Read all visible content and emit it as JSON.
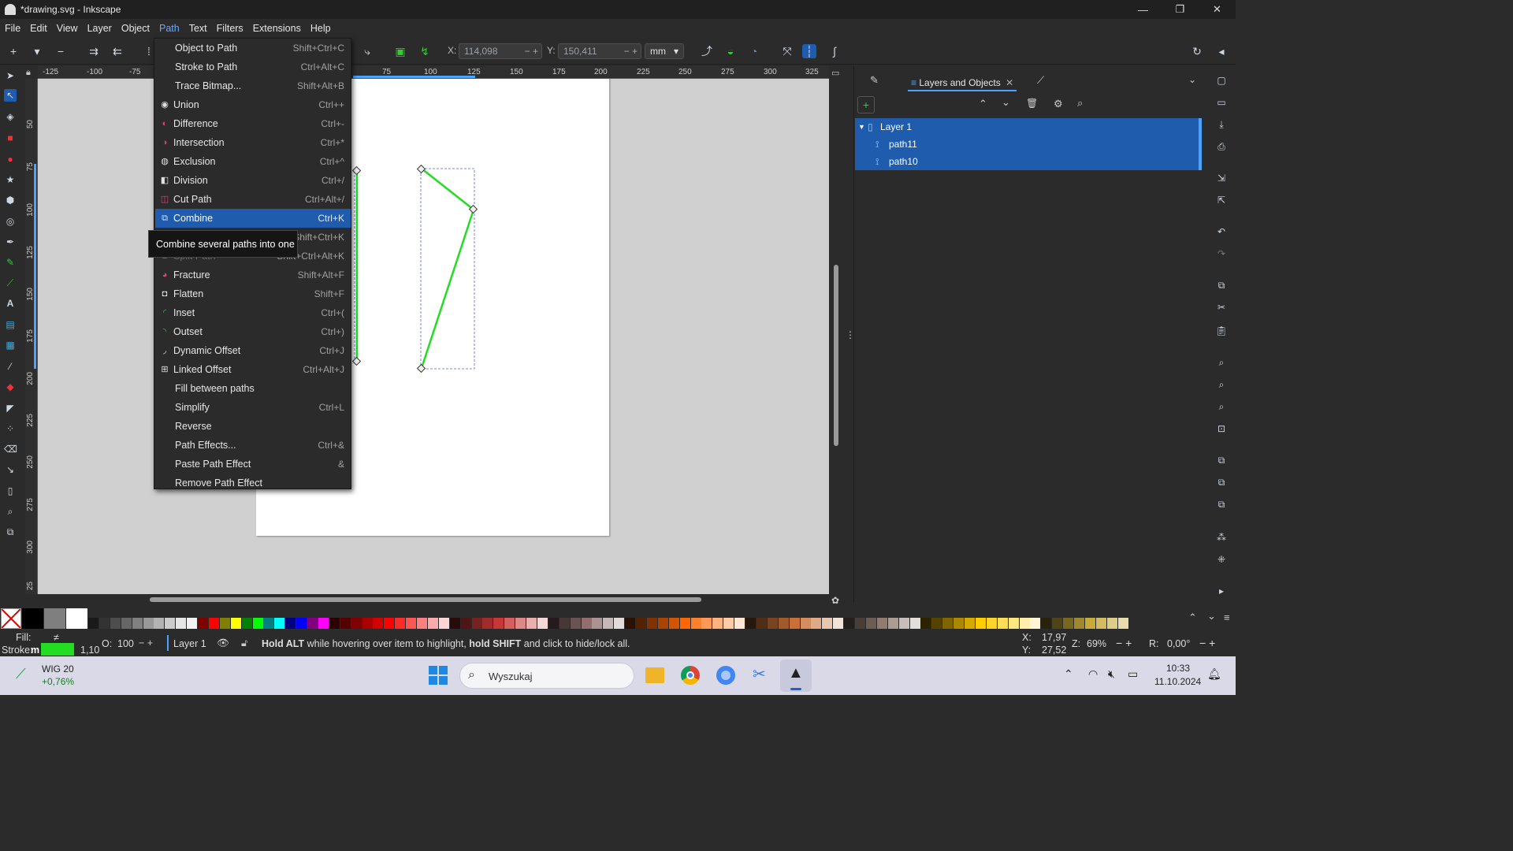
{
  "window": {
    "title": "*drawing.svg - Inkscape",
    "minimize": "—",
    "maximize": "❐",
    "close": "✕"
  },
  "menubar": [
    "File",
    "Edit",
    "View",
    "Layer",
    "Object",
    "Path",
    "Text",
    "Filters",
    "Extensions",
    "Help"
  ],
  "toolbar": {
    "x_label": "X:",
    "x_value": "114,098",
    "y_label": "Y:",
    "y_value": "150,411",
    "unit": "mm"
  },
  "rulers": {
    "h": [
      "-125",
      "-100",
      "-75",
      "75",
      "100",
      "125",
      "150",
      "175",
      "200",
      "225",
      "250",
      "275",
      "300",
      "325"
    ],
    "v": [
      "50",
      "75",
      "100",
      "125",
      "150",
      "175",
      "200",
      "225",
      "250",
      "275",
      "300",
      "25"
    ]
  },
  "path_menu": {
    "items": [
      {
        "label": "Object to Path",
        "shortcut": "Shift+Ctrl+C",
        "icon": "",
        "state": "normal"
      },
      {
        "label": "Stroke to Path",
        "shortcut": "Ctrl+Alt+C",
        "icon": "",
        "state": "normal"
      },
      {
        "label": "Trace Bitmap...",
        "shortcut": "Shift+Alt+B",
        "icon": "",
        "state": "normal"
      },
      {
        "label": "Union",
        "shortcut": "Ctrl++",
        "icon": "union-icon",
        "state": "normal"
      },
      {
        "label": "Difference",
        "shortcut": "Ctrl+-",
        "icon": "difference-icon",
        "state": "normal"
      },
      {
        "label": "Intersection",
        "shortcut": "Ctrl+*",
        "icon": "intersection-icon",
        "state": "normal"
      },
      {
        "label": "Exclusion",
        "shortcut": "Ctrl+^",
        "icon": "exclusion-icon",
        "state": "normal"
      },
      {
        "label": "Division",
        "shortcut": "Ctrl+/",
        "icon": "division-icon",
        "state": "normal"
      },
      {
        "label": "Cut Path",
        "shortcut": "Ctrl+Alt+/",
        "icon": "cut-path-icon",
        "state": "normal"
      },
      {
        "label": "Combine",
        "shortcut": "Ctrl+K",
        "icon": "combine-icon",
        "state": "highlighted"
      },
      {
        "label": "Break Apart",
        "shortcut": "Shift+Ctrl+K",
        "icon": "break-apart-icon",
        "state": "disabled"
      },
      {
        "label": "Split Path",
        "shortcut": "Shift+Ctrl+Alt+K",
        "icon": "split-path-icon",
        "state": "disabled"
      },
      {
        "label": "Fracture",
        "shortcut": "Shift+Alt+F",
        "icon": "fracture-icon",
        "state": "normal"
      },
      {
        "label": "Flatten",
        "shortcut": "Shift+F",
        "icon": "flatten-icon",
        "state": "normal"
      },
      {
        "label": "Inset",
        "shortcut": "Ctrl+(",
        "icon": "inset-icon",
        "state": "normal"
      },
      {
        "label": "Outset",
        "shortcut": "Ctrl+)",
        "icon": "outset-icon",
        "state": "normal"
      },
      {
        "label": "Dynamic Offset",
        "shortcut": "Ctrl+J",
        "icon": "dynamic-offset-icon",
        "state": "normal"
      },
      {
        "label": "Linked Offset",
        "shortcut": "Ctrl+Alt+J",
        "icon": "linked-offset-icon",
        "state": "normal"
      },
      {
        "label": "Fill between paths",
        "shortcut": "",
        "icon": "",
        "state": "normal"
      },
      {
        "label": "Simplify",
        "shortcut": "Ctrl+L",
        "icon": "",
        "state": "normal"
      },
      {
        "label": "Reverse",
        "shortcut": "",
        "icon": "",
        "state": "normal"
      },
      {
        "label": "Path Effects...",
        "shortcut": "Ctrl+&",
        "icon": "",
        "state": "normal"
      },
      {
        "label": "Paste Path Effect",
        "shortcut": "&",
        "icon": "",
        "state": "normal"
      },
      {
        "label": "Remove Path Effect",
        "shortcut": "",
        "icon": "",
        "state": "normal"
      }
    ]
  },
  "tooltip": "Combine several paths into one",
  "panel": {
    "tab_label": "Layers and Objects",
    "layers": [
      {
        "name": "Layer 1",
        "kind": "layer"
      },
      {
        "name": "path11",
        "kind": "path"
      },
      {
        "name": "path10",
        "kind": "path"
      }
    ]
  },
  "colors": {
    "accent": "#1f5cad",
    "stroke_green": "#22dd22",
    "palette": [
      "#000000",
      "#7f7f7f",
      "#ffffff",
      "#1a1a1a",
      "#333333",
      "#4d4d4d",
      "#666666",
      "#808080",
      "#999999",
      "#b3b3b3",
      "#cccccc",
      "#e6e6e6",
      "#f2f2f2",
      "#800000",
      "#ff0000",
      "#808000",
      "#ffff00",
      "#008000",
      "#00ff00",
      "#008080",
      "#00ffff",
      "#000080",
      "#0000ff",
      "#800080",
      "#ff00ff",
      "#2b0000",
      "#550000",
      "#800000",
      "#aa0000",
      "#d40000",
      "#ff0000",
      "#ff2a2a",
      "#ff5555",
      "#ff8080",
      "#ffaaaa",
      "#ffd5d5",
      "#280b0b",
      "#501616",
      "#782121",
      "#a02c2c",
      "#c83737",
      "#d35f5f",
      "#de8787",
      "#e9afaf",
      "#f4d7d7",
      "#241c1c",
      "#483737",
      "#6c5353",
      "#916f6f",
      "#ac9393",
      "#c8b7b7",
      "#e3dbdb",
      "#2b1100",
      "#552200",
      "#803300",
      "#aa4400",
      "#d45500",
      "#ff6600",
      "#ff7f2a",
      "#ff9955",
      "#ffb380",
      "#ffccaa",
      "#ffe6d5",
      "#28170b",
      "#502d16",
      "#784421",
      "#a05a2c",
      "#c87137",
      "#d38d5f",
      "#deaa87",
      "#e9c6af",
      "#f4e3d7",
      "#241f1c",
      "#483e37",
      "#6c5d53",
      "#917c6f",
      "#ac9d93",
      "#c8beb7",
      "#e3dedb",
      "#2b2200",
      "#554400",
      "#806600",
      "#aa8800",
      "#d4aa00",
      "#ffcc00",
      "#ffd42a",
      "#ffdd55",
      "#ffe680",
      "#ffeeaa",
      "#fff6d5",
      "#28220b",
      "#504416",
      "#786721",
      "#a0892c",
      "#c8ab37",
      "#d3bc5f",
      "#decd87",
      "#e9ddaf"
    ]
  },
  "statusbar": {
    "fill_label": "Fill:",
    "fill_value": "≠",
    "stroke_label": "Stroke:",
    "stroke_value": "m",
    "stroke_width": "1,10",
    "opacity_label": "O:",
    "opacity_value": "100",
    "layer_name": "Layer 1",
    "message_part1": "Hold ALT",
    "message_part2": " while hovering over item to highlight, ",
    "message_part3": "hold SHIFT",
    "message_part4": " and click to hide/lock all.",
    "x_label": "X:",
    "x_value": "17,97",
    "y_label": "Y:",
    "y_value": "27,52",
    "zoom_label": "Z:",
    "zoom_value": "69%",
    "rotate_label": "R:",
    "rotate_value": "0,00°"
  },
  "taskbar": {
    "widget_title": "WIG 20",
    "widget_value": "+0,76%",
    "search_placeholder": "Wyszukaj",
    "time": "10:33",
    "date": "11.10.2024"
  }
}
